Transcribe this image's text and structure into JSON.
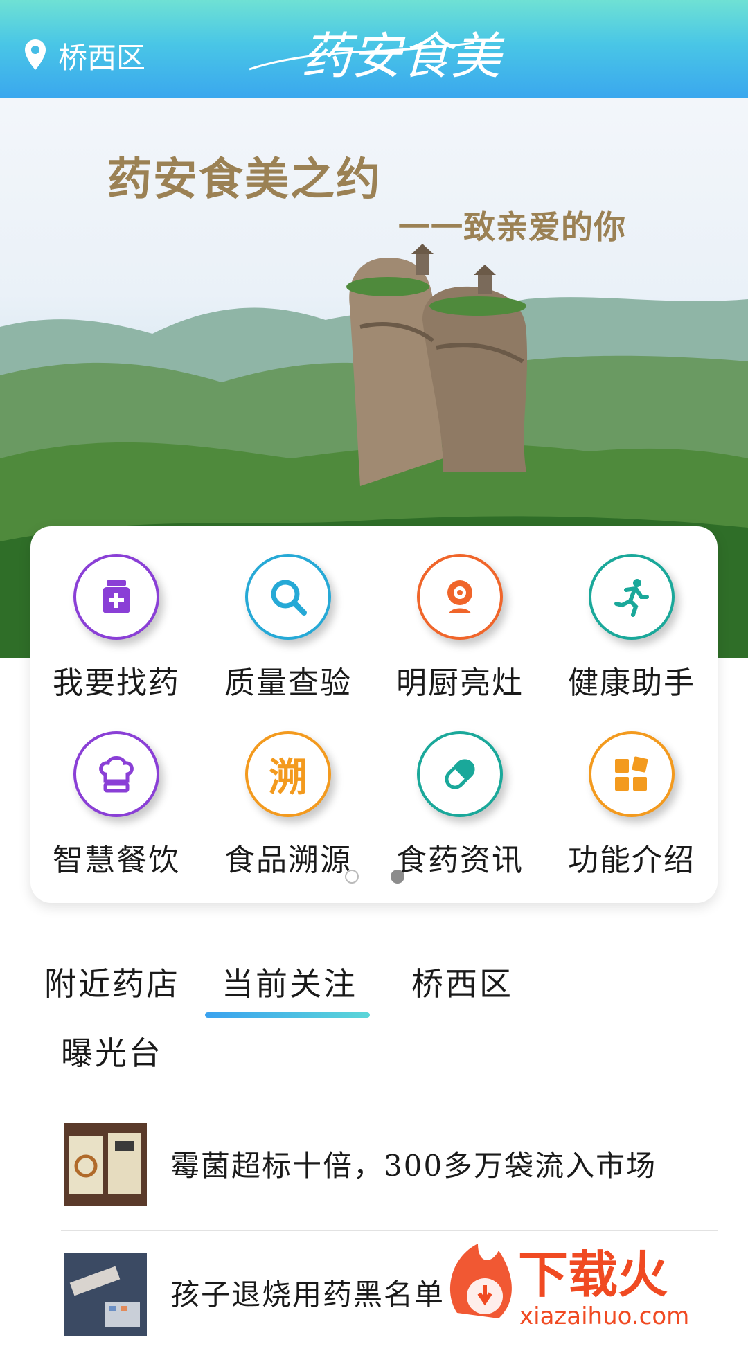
{
  "header": {
    "location": "桥西区",
    "logo_text": "药安食美"
  },
  "banner": {
    "title": "药安食美之约",
    "subtitle": "一一致亲爱的你"
  },
  "services": [
    {
      "label": "我要找药",
      "icon": "medicine-bottle-icon",
      "color": "#8a3fd6"
    },
    {
      "label": "质量查验",
      "icon": "search-icon",
      "color": "#26a9d6"
    },
    {
      "label": "明厨亮灶",
      "icon": "camera-icon",
      "color": "#f0652a"
    },
    {
      "label": "健康助手",
      "icon": "running-person-icon",
      "color": "#1aa89a"
    },
    {
      "label": "智慧餐饮",
      "icon": "chef-hat-icon",
      "color": "#8a3fd6"
    },
    {
      "label": "食品溯源",
      "icon": "trace-source-icon",
      "color": "#f39a1e",
      "icon_text": "溯"
    },
    {
      "label": "食药资讯",
      "icon": "pill-icon",
      "color": "#1aa89a"
    },
    {
      "label": "功能介绍",
      "icon": "grid-icon",
      "color": "#f39a1e"
    }
  ],
  "pager": {
    "pages": 2,
    "active": 2
  },
  "tabs": {
    "items": [
      "附近药店",
      "当前关注",
      "桥西区",
      "曝光台"
    ],
    "active": "当前关注"
  },
  "news": [
    {
      "title": "霉菌超标十倍，300多万袋流入市场"
    },
    {
      "title": "孩子退烧用药黑名单"
    }
  ],
  "watermark": {
    "brand": "下载火",
    "url": "xiazaihuo.com"
  }
}
